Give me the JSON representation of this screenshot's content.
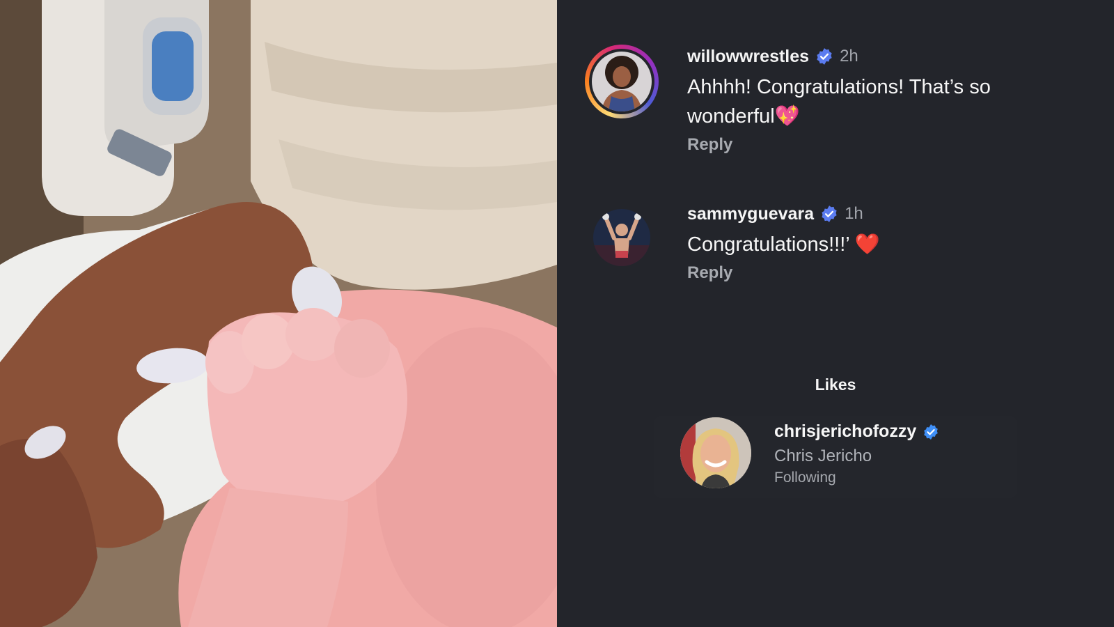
{
  "comments": [
    {
      "username": "willowwrestles",
      "time": "2h",
      "text": "Ahhhh! Congratulations! That’s so wonderful",
      "emoji": "💖",
      "reply_label": "Reply",
      "verified": true
    },
    {
      "username": "sammyguevara",
      "time": "1h",
      "text": "Congratulations!!!’ ",
      "emoji": "❤️",
      "reply_label": "Reply",
      "verified": true
    }
  ],
  "likes": {
    "title": "Likes",
    "users": [
      {
        "username": "chrisjerichofozzy",
        "full_name": "Chris Jericho",
        "status": "Following",
        "verified": true
      }
    ]
  },
  "colors": {
    "background": "#23252b",
    "verified_badge": "#3f8ff7",
    "muted_text": "#a3a6ad"
  },
  "icons": [
    "verified-badge-icon",
    "avatar-story-ring"
  ]
}
